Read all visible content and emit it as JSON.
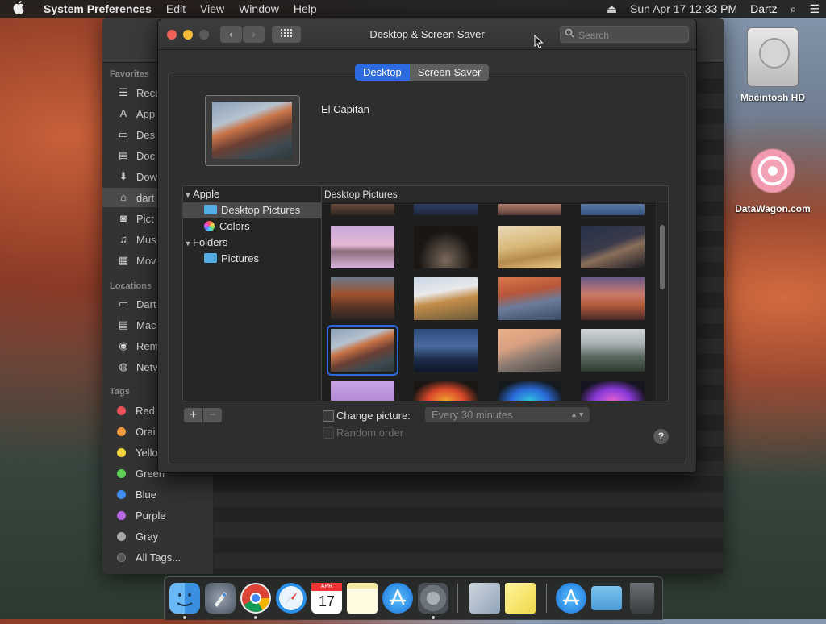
{
  "menubar": {
    "apple": "",
    "app_name": "System Preferences",
    "menus": [
      "Edit",
      "View",
      "Window",
      "Help"
    ],
    "eject": "⏏",
    "datetime": "Sun Apr 17  12:33 PM",
    "user": "Dartz",
    "search_icon": "⌕",
    "list_icon": "☰"
  },
  "finder": {
    "favorites_header": "Favorites",
    "favorites": [
      {
        "label": "Rece",
        "icon": "recents-icon",
        "glyph": "☰"
      },
      {
        "label": "App",
        "icon": "applications-icon",
        "glyph": "A"
      },
      {
        "label": "Des",
        "icon": "desktop-icon",
        "glyph": "▭"
      },
      {
        "label": "Doc",
        "icon": "documents-icon",
        "glyph": "▤"
      },
      {
        "label": "Dow",
        "icon": "downloads-icon",
        "glyph": "⬇"
      },
      {
        "label": "dart",
        "icon": "home-icon",
        "glyph": "⌂"
      },
      {
        "label": "Pict",
        "icon": "pictures-icon",
        "glyph": "◙"
      },
      {
        "label": "Mus",
        "icon": "music-icon",
        "glyph": "♫"
      },
      {
        "label": "Mov",
        "icon": "movies-icon",
        "glyph": "▦"
      }
    ],
    "locations_header": "Locations",
    "locations": [
      {
        "label": "Dart",
        "icon": "computer-icon",
        "glyph": "▭"
      },
      {
        "label": "Mac",
        "icon": "hard-drive-icon",
        "glyph": "▤"
      },
      {
        "label": "Rem",
        "icon": "disc-icon",
        "glyph": "◉"
      },
      {
        "label": "Netv",
        "icon": "network-icon",
        "glyph": "◍"
      }
    ],
    "tags_header": "Tags",
    "tags": [
      {
        "label": "Red",
        "color": "#f0525a"
      },
      {
        "label": "Orai",
        "color": "#f49a3a"
      },
      {
        "label": "Yello",
        "color": "#f5d23b"
      },
      {
        "label": "Green",
        "color": "#5ecf56"
      },
      {
        "label": "Blue",
        "color": "#3f8ef5"
      },
      {
        "label": "Purple",
        "color": "#b865e6"
      },
      {
        "label": "Gray",
        "color": "#a6a6a6"
      },
      {
        "label": "All Tags...",
        "color": "#555555"
      }
    ]
  },
  "desktop_icons": {
    "hd_label": "Macintosh HD",
    "site_label": "DataWagon.com"
  },
  "prefs": {
    "title": "Desktop & Screen Saver",
    "back_glyph": "‹",
    "forward_glyph": "›",
    "grid_glyph": "⠿⠿",
    "search_placeholder": "Search",
    "tabs": [
      "Desktop",
      "Screen Saver"
    ],
    "current_wallpaper": "El Capitan",
    "source_list": {
      "group_apple": "Apple",
      "item_desktop_pictures": "Desktop Pictures",
      "item_colors": "Colors",
      "group_folders": "Folders",
      "item_pictures": "Pictures"
    },
    "gallery_header": "Desktop Pictures",
    "add_glyph": "+",
    "remove_glyph": "−",
    "change_picture_label": "Change picture:",
    "change_interval": "Every 30 minutes",
    "random_order_label": "Random order",
    "help_glyph": "?",
    "accent_color": "#2b6ae0"
  },
  "dock": {
    "apps": [
      "Finder",
      "Launchpad",
      "Chrome",
      "Safari",
      "Calendar",
      "Notes",
      "App Store",
      "System Preferences",
      "Preview",
      "Stickies",
      "Downloads",
      "Folder",
      "Trash"
    ],
    "calendar_month": "APR",
    "calendar_day": "17"
  }
}
